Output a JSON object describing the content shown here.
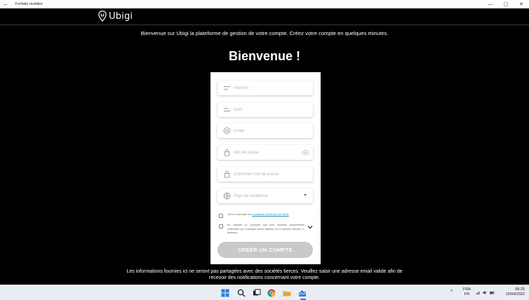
{
  "window": {
    "title": "Forfaits mobiles",
    "back_glyph": "←",
    "minimize_glyph": "—",
    "maximize_glyph": "▢",
    "close_glyph": "✕"
  },
  "header": {
    "logo_text": "Ubigi"
  },
  "intro": "Bienvenue sur Ubigi la plateforme de gestion de votre compte. Créez votre compte en quelques minutes.",
  "welcome_title": "Bienvenue !",
  "form": {
    "first_name_placeholder": "Prénom",
    "last_name_placeholder": "Nom",
    "email_placeholder": "Email",
    "password_placeholder": "Mot de passe",
    "confirm_password_placeholder": "Confirmer mot de passe",
    "country_placeholder": "Pays de résidence",
    "terms_prefix": "J'ai lu et accepté les",
    "terms_link": "Conditions Générales de Vente",
    "consent_text": "En cliquant ici, j'accepte que mes données personnelles collectées par Transatel soient traitées de la manière décrite ci-dessous.",
    "submit_label": "CRÉER UN COMPTE"
  },
  "footer": "Les informations fournies ici ne seront pas partagées avec des sociétés tierces. Veuillez saisir une adresse email valide afin de recevoir des notifications concernant votre compte.",
  "taskbar": {
    "lang_top": "FRA",
    "lang_bottom": "FR",
    "time": "08:25",
    "date": "10/04/2022",
    "tray_overflow_glyph": "^"
  },
  "colors": {
    "background": "#000000",
    "card": "#ffffff",
    "button_disabled": "#c9c9c9",
    "link": "#1d8fb7",
    "taskbar": "#e9eef5"
  }
}
